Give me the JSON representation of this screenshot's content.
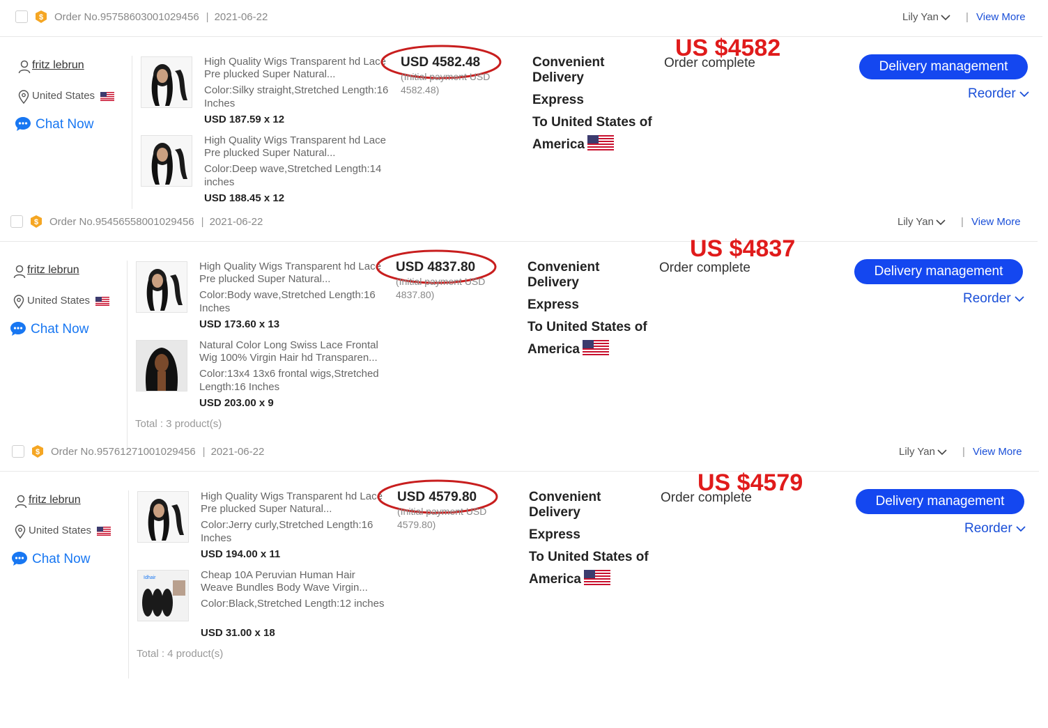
{
  "orders": [
    {
      "order_no": "Order No.95758603001029456",
      "date": "2021-06-22",
      "seller": "Lily Yan",
      "view_more": "View More",
      "buyer": "fritz lebrun",
      "country": "United States",
      "chat": "Chat Now",
      "products": [
        {
          "name": "High Quality Wigs Transparent hd Lace Pre plucked Super Natural...",
          "variant": "Color:Silky straight,Stretched Length:16 Inches",
          "price": "USD 187.59 x 12"
        },
        {
          "name": "High Quality Wigs Transparent hd Lace Pre plucked Super Natural...",
          "variant": "Color:Deep wave,Stretched Length:14 inches",
          "price": "USD 188.45 x 12"
        }
      ],
      "total_price": "USD 4582.48",
      "initial_payment": "(Initial payment USD 4582.48)",
      "shipping_method": "Convenient Delivery",
      "shipping_type": "Express",
      "shipping_to": "To United States of",
      "shipping_country": "America",
      "status": "Order complete",
      "annotation": "US $4582",
      "delivery_button": "Delivery management",
      "reorder": "Reorder",
      "total_products": ""
    },
    {
      "order_no": "Order No.95456558001029456",
      "date": "2021-06-22",
      "seller": "Lily Yan",
      "view_more": "View More",
      "buyer": "fritz lebrun",
      "country": "United States",
      "chat": "Chat Now",
      "products": [
        {
          "name": "High Quality Wigs Transparent hd Lace Pre plucked Super Natural...",
          "variant": "Color:Body wave,Stretched Length:16 Inches",
          "price": "USD 173.60 x 13"
        },
        {
          "name": "Natural Color Long Swiss Lace Frontal Wig 100% Virgin Hair hd Transparen...",
          "variant": "Color:13x4 13x6 frontal wigs,Stretched Length:16 Inches",
          "price": "USD 203.00 x 9"
        }
      ],
      "total_price": "USD 4837.80",
      "initial_payment": "(Initial payment USD 4837.80)",
      "shipping_method": "Convenient Delivery",
      "shipping_type": "Express",
      "shipping_to": "To United States of",
      "shipping_country": "America",
      "status": "Order complete",
      "annotation": "US $4837",
      "delivery_button": "Delivery management",
      "reorder": "Reorder",
      "total_products": "Total : 3 product(s)"
    },
    {
      "order_no": "Order No.95761271001029456",
      "date": "2021-06-22",
      "seller": "Lily Yan",
      "view_more": "View More",
      "buyer": "fritz lebrun",
      "country": "United States",
      "chat": "Chat Now",
      "products": [
        {
          "name": "High Quality Wigs Transparent hd Lace Pre plucked Super Natural...",
          "variant": "Color:Jerry curly,Stretched Length:16 Inches",
          "price": "USD 194.00 x 11"
        },
        {
          "name": "Cheap 10A Peruvian Human Hair Weave Bundles Body Wave Virgin...",
          "variant": "Color:Black,Stretched Length:12 inches",
          "price": "USD 31.00 x 18"
        }
      ],
      "total_price": "USD 4579.80",
      "initial_payment": "(Initial payment USD 4579.80)",
      "shipping_method": "Convenient Delivery",
      "shipping_type": "Express",
      "shipping_to": "To United States of",
      "shipping_country": "America",
      "status": "Order complete",
      "annotation": "US $4579",
      "delivery_button": "Delivery management",
      "reorder": "Reorder",
      "total_products": "Total : 4 product(s)"
    }
  ],
  "colors": {
    "link_blue": "#1a4fd8",
    "button_blue": "#1447f0",
    "chat_blue": "#1877f2",
    "annotation_red": "#e01b1b",
    "shop_badge": "#f5a623"
  },
  "icons": [
    "shop-badge-icon",
    "user-icon",
    "location-pin-icon",
    "us-flag-icon",
    "chat-bubble-icon",
    "chevron-down-icon"
  ]
}
